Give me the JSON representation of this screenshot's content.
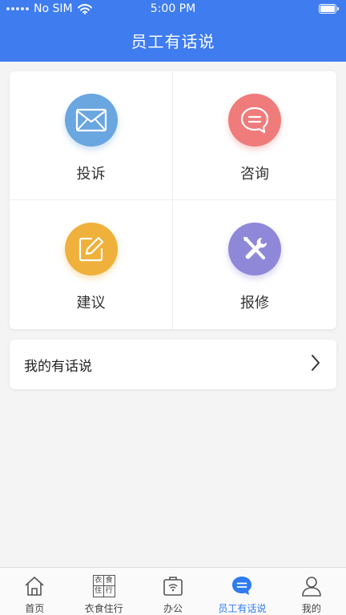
{
  "status_bar": {
    "carrier": "No SIM",
    "time": "5:00 PM"
  },
  "header": {
    "title": "员工有话说"
  },
  "grid": {
    "items": [
      {
        "label": "投诉",
        "icon": "mail-icon",
        "color": "#6aa6e0"
      },
      {
        "label": "咨询",
        "icon": "chat-bubble-icon",
        "color": "#ef7b7b"
      },
      {
        "label": "建议",
        "icon": "edit-icon",
        "color": "#efb13b"
      },
      {
        "label": "报修",
        "icon": "tools-icon",
        "color": "#8f88d9"
      }
    ]
  },
  "my_posts": {
    "label": "我的有话说",
    "icon": "chevron-right-icon"
  },
  "tabbar": {
    "tabs": [
      {
        "label": "首页",
        "icon": "home-icon",
        "active": false
      },
      {
        "label": "衣食住行",
        "icon": "life-grid-icon",
        "icon_chars": [
          "衣",
          "食",
          "住",
          "行"
        ],
        "active": false
      },
      {
        "label": "办公",
        "icon": "office-bag-icon",
        "active": false
      },
      {
        "label": "员工有话说",
        "icon": "chat-bubble-icon",
        "active": true
      },
      {
        "label": "我的",
        "icon": "user-icon",
        "active": false
      }
    ],
    "active_color": "#2f7bf0"
  },
  "colors": {
    "header_bg": "#3e7cf0",
    "page_bg": "#f4f4f4"
  }
}
